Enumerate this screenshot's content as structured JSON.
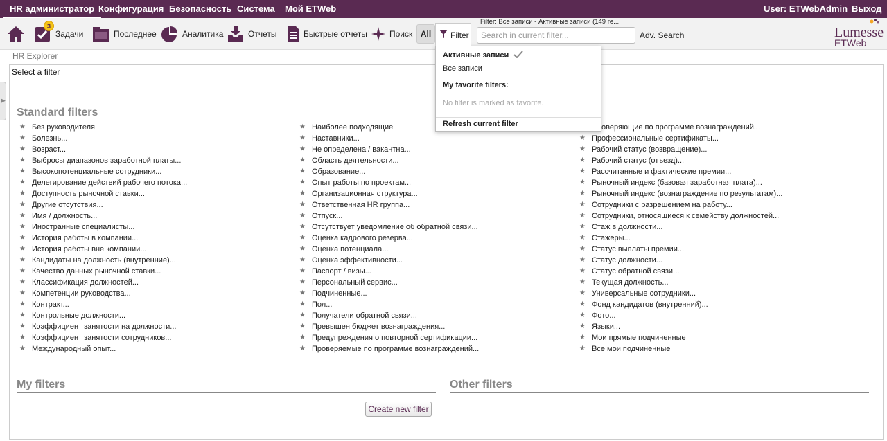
{
  "topbar": {
    "menus": [
      "HR администратор",
      "Конфигурация",
      "Безопасность",
      "Система",
      "Мой ETWeb"
    ],
    "user": "User: ETWebAdmin",
    "logout": "Выход"
  },
  "toolbar": {
    "tasks_badge": "3",
    "buttons": [
      "Задачи",
      "Последнее",
      "Аналитика",
      "Отчеты",
      "Быстрые отчеты",
      "Поиск"
    ],
    "all": "All",
    "filter": "Filter",
    "filter_status": "Filter: Все записи - Активные записи (149 re...",
    "search_placeholder": "Search in current filter...",
    "adv_search": "Adv. Search"
  },
  "logo": {
    "line1": "Lumesse",
    "line2": "ETWeb"
  },
  "breadcrumb": "HR Explorer",
  "panel": {
    "title": "Select a filter",
    "standard_title": "Standard filters",
    "my_title": "My filters",
    "other_title": "Other filters",
    "create_button": "Create new filter",
    "col1": [
      "Без руководителя",
      "Болезнь...",
      "Возраст...",
      "Выбросы диапазонов заработной платы...",
      "Высокопотенциальные сотрудники...",
      "Делегирование действий рабочего потока...",
      "Доступность рыночной ставки...",
      "Другие отсутствия...",
      "Имя / должность...",
      "Иностранные специалисты...",
      "История работы в компании...",
      "История работы вне компании...",
      "Кандидаты на должность (внутренние)...",
      "Качество данных рыночной ставки...",
      "Классификация должностей...",
      "Компетенции руководства...",
      "Контракт...",
      "Контрольные должности...",
      "Коэффициент занятости на должности...",
      "Коэффициент занятости сотрудников...",
      "Международный опыт..."
    ],
    "col2": [
      "Наиболее подходящие",
      "Наставники...",
      "Не определена / вакантна...",
      "Область деятельности...",
      "Образование...",
      "Опыт работы по проектам...",
      "Организационная структура...",
      "Ответственная HR группа...",
      "Отпуск...",
      "Отсутствует уведомление об обратной связи...",
      "Оценка кадрового резерва...",
      "Оценка потенциала...",
      "Оценка эффективности...",
      "Паспорт / визы...",
      "Персональный сервис...",
      "Подчиненные...",
      "Пол...",
      "Получатели обратной связи...",
      "Превышен бюджет вознаграждения...",
      "Предупреждения о повторной сертификации...",
      "Проверяемые по программе вознаграждений..."
    ],
    "col3": [
      "Проверяющие по программе вознаграждений...",
      "Профессиональные сертификаты...",
      "Рабочий статус (возвращение)...",
      "Рабочий статус (отъезд)...",
      "Рассчитанные и фактические премии...",
      "Рыночный индекс (базовая заработная плата)...",
      "Рыночный индекс (вознаграждение по результатам)...",
      "Сотрудники с разрешением на работу...",
      "Сотрудники, относящиеся к семейству должностей...",
      "Стаж в должности...",
      "Стажеры...",
      "Статус выплаты премии...",
      "Статус должности...",
      "Статус обратной связи...",
      "Текущая должность...",
      "Универсальные сотрудники...",
      "Фонд кандидатов (внутренний)...",
      "Фото...",
      "Языки...",
      "Мои прямые подчиненные",
      "Все мои подчиненные"
    ]
  },
  "dropdown": {
    "active": "Активные записи",
    "all": "Все записи",
    "favorites_title": "My favorite filters:",
    "no_favorite": "No filter is marked as favorite.",
    "refresh": "Refresh current filter"
  }
}
